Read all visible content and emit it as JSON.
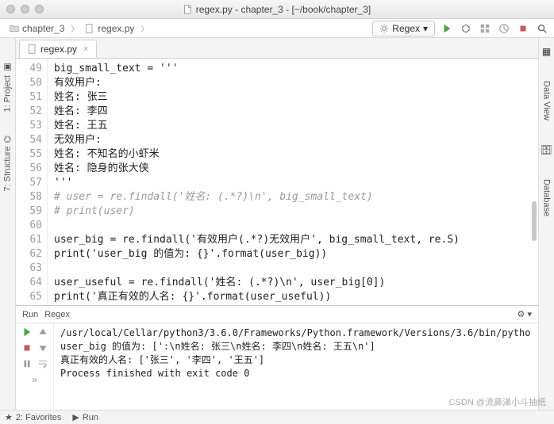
{
  "window": {
    "title": "regex.py - chapter_3 - [~/book/chapter_3]"
  },
  "breadcrumb": {
    "folder": "chapter_3",
    "file": "regex.py"
  },
  "toolbar": {
    "run_config": "Regex"
  },
  "editor": {
    "tab_label": "regex.py",
    "lines": [
      {
        "n": 49,
        "text": "big_small_text = '''",
        "cls": ""
      },
      {
        "n": 50,
        "text": "有效用户:",
        "cls": ""
      },
      {
        "n": 51,
        "text": "姓名: 张三",
        "cls": ""
      },
      {
        "n": 52,
        "text": "姓名: 李四",
        "cls": ""
      },
      {
        "n": 53,
        "text": "姓名: 王五",
        "cls": ""
      },
      {
        "n": 54,
        "text": "无效用户:",
        "cls": ""
      },
      {
        "n": 55,
        "text": "姓名: 不知名的小虾米",
        "cls": ""
      },
      {
        "n": 56,
        "text": "姓名: 隐身的张大侠",
        "cls": ""
      },
      {
        "n": 57,
        "text": "'''",
        "cls": ""
      },
      {
        "n": 58,
        "text": "# user = re.findall('姓名: (.*?)\\n', big_small_text)",
        "cls": "cmt"
      },
      {
        "n": 59,
        "text": "# print(user)",
        "cls": "cmt"
      },
      {
        "n": 60,
        "text": "",
        "cls": ""
      },
      {
        "n": 61,
        "text": "user_big = re.findall('有效用户(.*?)无效用户', big_small_text, re.S)",
        "cls": ""
      },
      {
        "n": 62,
        "text": "print('user_big 的值为: {}'.format(user_big))",
        "cls": ""
      },
      {
        "n": 63,
        "text": "",
        "cls": ""
      },
      {
        "n": 64,
        "text": "user_useful = re.findall('姓名: (.*?)\\n', user_big[0])",
        "cls": ""
      },
      {
        "n": 65,
        "text": "print('真正有效的人名: {}'.format(user_useful))",
        "cls": ""
      }
    ]
  },
  "run": {
    "title": "Run",
    "config": "Regex",
    "lines": [
      "/usr/local/Cellar/python3/3.6.0/Frameworks/Python.framework/Versions/3.6/bin/pytho",
      "user_big 的值为: [':\\n姓名: 张三\\n姓名: 李四\\n姓名: 王五\\n']",
      "真正有效的人名: ['张三', '李四', '王五']",
      "",
      "Process finished with exit code 0"
    ]
  },
  "sidebars": {
    "left": [
      "1: Project",
      "7: Structure"
    ],
    "right": [
      "Data View",
      "Database"
    ],
    "bottom": [
      "2: Favorites",
      "Run"
    ]
  },
  "watermark": "CSDN @流鼻涕小斗抽纸"
}
